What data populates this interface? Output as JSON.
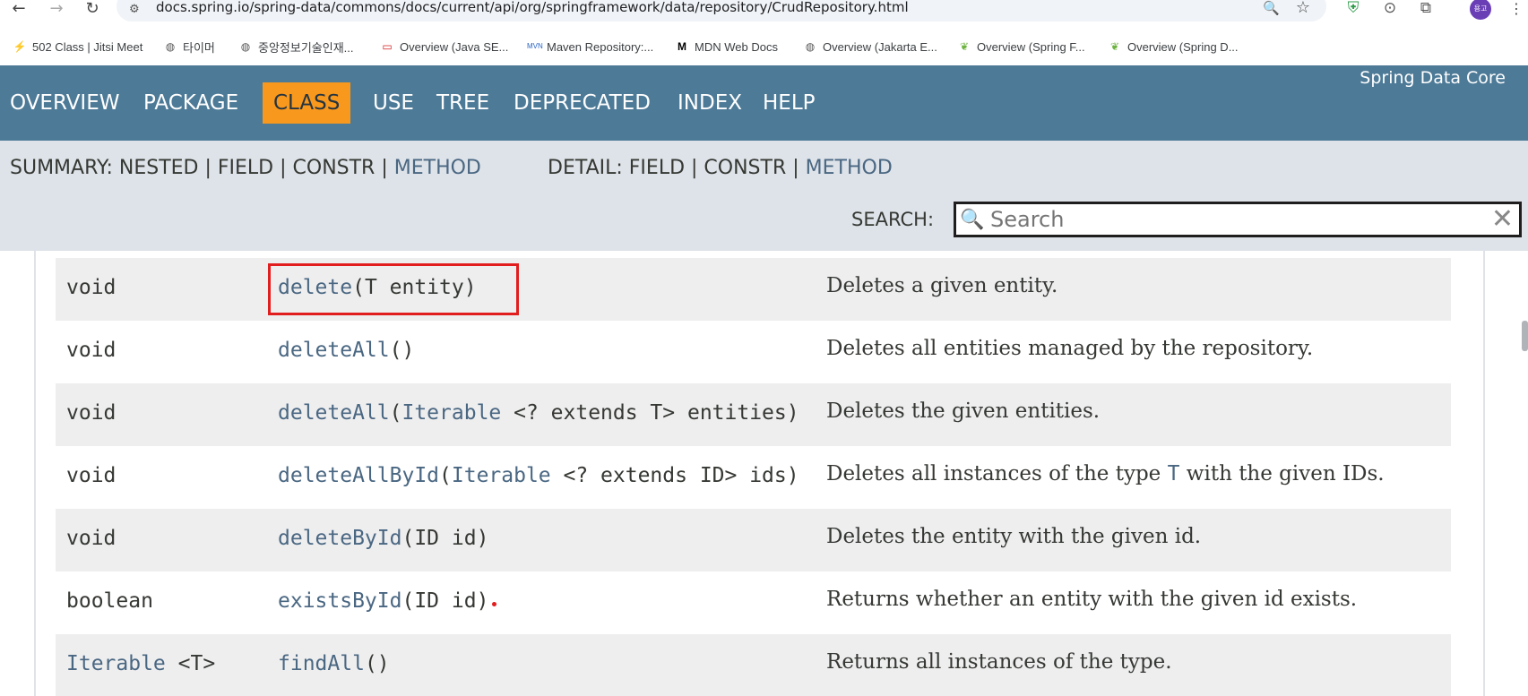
{
  "browser": {
    "url": "docs.spring.io/spring-data/commons/docs/current/api/org/springframework/data/repository/CrudRepository.html",
    "avatar_initials": "용고",
    "bookmarks": [
      {
        "label": "502 Class | Jitsi Meet",
        "icon": "jitsi-icon"
      },
      {
        "label": "타이머",
        "icon": "globe-icon"
      },
      {
        "label": "중앙정보기술인재...",
        "icon": "globe-icon"
      },
      {
        "label": "Overview (Java SE...",
        "icon": "oracle-icon"
      },
      {
        "label": "Maven Repository:...",
        "icon": "maven-icon"
      },
      {
        "label": "MDN Web Docs",
        "icon": "mdn-icon"
      },
      {
        "label": "Overview (Jakarta E...",
        "icon": "globe-icon"
      },
      {
        "label": "Overview (Spring F...",
        "icon": "spring-icon"
      },
      {
        "label": "Overview (Spring D...",
        "icon": "spring-icon"
      }
    ]
  },
  "nav": {
    "items": [
      "OVERVIEW",
      "PACKAGE",
      "CLASS",
      "USE",
      "TREE",
      "DEPRECATED",
      "INDEX",
      "HELP"
    ],
    "active": "CLASS",
    "brand": "Spring Data Core"
  },
  "subnav": {
    "summary_prefix": "SUMMARY: NESTED | FIELD | CONSTR | ",
    "summary_method": "METHOD",
    "detail_prefix": "DETAIL: FIELD | CONSTR | ",
    "detail_method": "METHOD",
    "search_label": "SEARCH:",
    "search_placeholder": "Search"
  },
  "methods": [
    {
      "type": "void",
      "name": "delete",
      "params": "(T entity)",
      "desc": "Deletes a given entity."
    },
    {
      "type": "void",
      "name": "deleteAll",
      "params": "()",
      "desc": "Deletes all entities managed by the repository."
    },
    {
      "type": "void",
      "name": "deleteAll",
      "params_kw": "Iterable",
      "params_rest": " <? extends T> entities)",
      "desc": "Deletes the given entities."
    },
    {
      "type": "void",
      "name": "deleteAllById",
      "params_kw": "Iterable",
      "params_rest": " <? extends ID> ids)",
      "desc_pre": "Deletes all instances of the type ",
      "desc_code": "T",
      "desc_post": " with the given IDs."
    },
    {
      "type": "void",
      "name": "deleteById",
      "params": "(ID id)",
      "desc": "Deletes the entity with the given id."
    },
    {
      "type": "boolean",
      "name": "existsById",
      "params": "(ID id)",
      "desc": "Returns whether an entity with the given id exists."
    },
    {
      "type_kw": "Iterable",
      "type_rest": " <T>",
      "name": "findAll",
      "params": "()",
      "desc": "Returns all instances of the type."
    }
  ],
  "colors": {
    "nav_bg": "#4d7a97",
    "active_tab": "#f8981d",
    "subnav_bg": "#dee3e9",
    "link": "#4a6782",
    "highlight": "#e11d1d"
  }
}
